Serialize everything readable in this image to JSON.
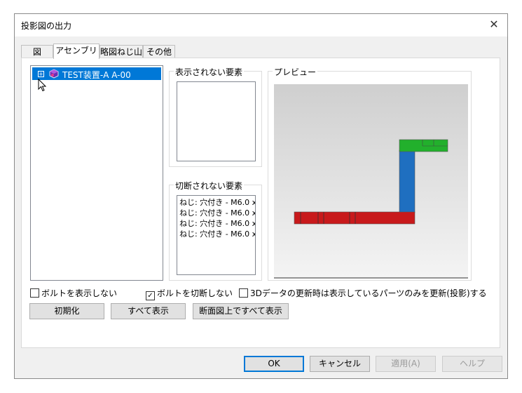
{
  "window": {
    "title": "投影図の出力"
  },
  "tabs": [
    {
      "label": "図"
    },
    {
      "label": "アセンブリ"
    },
    {
      "label": "略図ねじ山"
    },
    {
      "label": "その他"
    }
  ],
  "tree": {
    "items": [
      {
        "label": "TEST装置-A A-00",
        "expanded": false,
        "selected": true
      }
    ]
  },
  "hidden_elements": {
    "title": "表示されない要素",
    "items": []
  },
  "uncut_elements": {
    "title": "切断されない要素",
    "items": [
      "ねじ: 穴付き - M6.0 x",
      "ねじ: 穴付き - M6.0 x",
      "ねじ: 穴付き - M6.0 x",
      "ねじ: 穴付き - M6.0 x"
    ]
  },
  "preview": {
    "title": "プレビュー",
    "colors": {
      "red": "#c8191b",
      "blue": "#1f6fc0",
      "green": "#22b02c"
    }
  },
  "options": {
    "hide_bolts": {
      "label": "ボルトを表示しない",
      "checked": false
    },
    "no_cut_bolts": {
      "label": "ボルトを切断しない",
      "checked": true
    },
    "update_visible_only": {
      "label": "3Dデータの更新時は表示しているパーツのみを更新(投影)する",
      "checked": false
    }
  },
  "actions": {
    "reset": "初期化",
    "show_all": "すべて表示",
    "show_all_section": "断面図上ですべて表示"
  },
  "footer": {
    "ok": "OK",
    "cancel": "キャンセル",
    "apply": "適用(A)",
    "help": "ヘルプ"
  },
  "colors": {
    "selection": "#0078d7",
    "accent": "#0078d7"
  }
}
